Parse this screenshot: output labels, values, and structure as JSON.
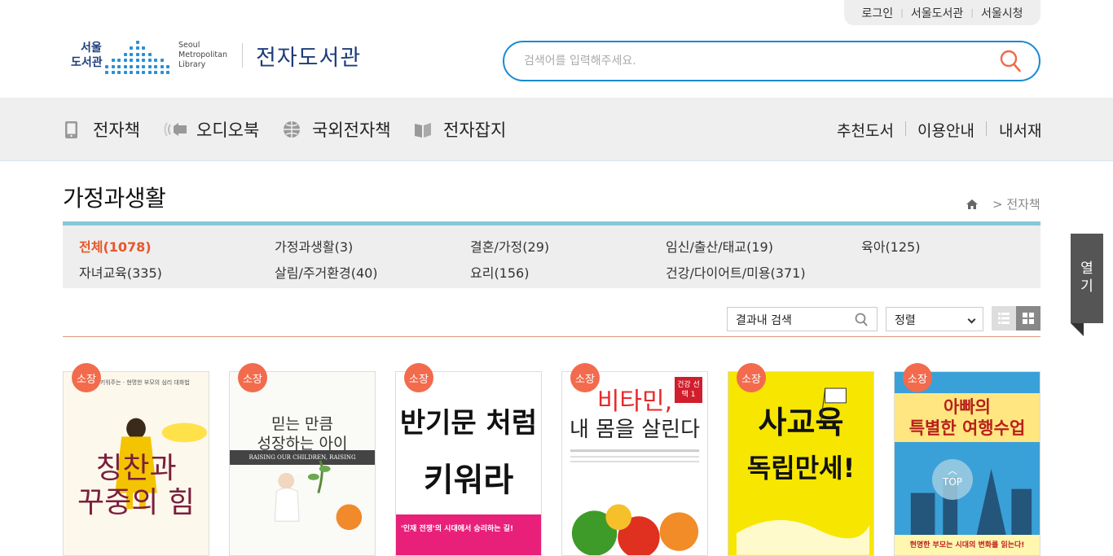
{
  "utility": {
    "login": "로그인",
    "library": "서울도서관",
    "city": "서울시청"
  },
  "logo": {
    "ko_line1": "서울",
    "ko_line2": "도서관",
    "en_line1": "Seoul",
    "en_line2": "Metropolitan",
    "en_line3": "Library",
    "title": "전자도서관"
  },
  "search": {
    "placeholder": "검색어를 입력해주세요."
  },
  "nav": {
    "items": [
      {
        "label": "전자책"
      },
      {
        "label": "오디오북"
      },
      {
        "label": "국외전자책"
      },
      {
        "label": "전자잡지"
      }
    ],
    "right": [
      {
        "label": "추천도서"
      },
      {
        "label": "이용안내"
      },
      {
        "label": "내서재"
      }
    ]
  },
  "page": {
    "title": "가정과생활",
    "breadcrumb": "> 전자책"
  },
  "categories": [
    {
      "label": "전체(1078)"
    },
    {
      "label": "가정과생활(3)"
    },
    {
      "label": "결혼/가정(29)"
    },
    {
      "label": "임신/출산/태교(19)"
    },
    {
      "label": "육아(125)"
    },
    {
      "label": "자녀교육(335)"
    },
    {
      "label": "살림/주거환경(40)"
    },
    {
      "label": "요리(156)"
    },
    {
      "label": "건강/다이어트/미용(371)"
    }
  ],
  "toolbar": {
    "search_placeholder": "결과내 검색",
    "sort_label": "정렬"
  },
  "badge": "소장",
  "books": [
    {
      "line1": "칭찬과",
      "line2": "꾸중의 힘",
      "top": "칭찬을 키워주는 · 현명한 부모의 심리 대화법",
      "accent": "#fff8dc"
    },
    {
      "line1": "믿는 만큼",
      "line2": "성장하는 아이",
      "top": "RAISING OUR CHILDREN, RAISING OURSELVES",
      "accent": "#ffffff"
    },
    {
      "line1": "반기문 처럼",
      "line2": "키워라",
      "top": "'인재 전쟁'의 시대에서 승리하는 길!",
      "accent": "#ffffff"
    },
    {
      "line1": "비타민,",
      "line2": "내 몸을 살린다",
      "top": "건강 선택 1",
      "accent": "#ffffff"
    },
    {
      "line1": "사교육",
      "line2": "독립만세!",
      "top": "",
      "accent": "#f7e600"
    },
    {
      "line1": "아빠의",
      "line2": "특별한 여행수업",
      "top": "현명한 부모는 시대의 변화를 읽는다!",
      "accent": "#3aa0d8"
    }
  ],
  "side": {
    "open_line1": "열",
    "open_line2": "기"
  },
  "top_button": "TOP"
}
